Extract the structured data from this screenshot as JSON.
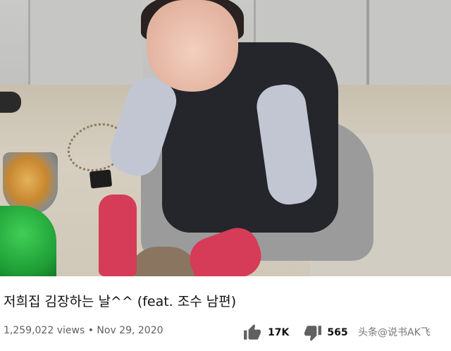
{
  "video": {
    "title": "저희집 김장하는 날^^ (feat. 조수 남편)",
    "views": "1,259,022 views",
    "separator": "•",
    "date": "Nov 29, 2020"
  },
  "actions": {
    "like_count": "17K",
    "dislike_count": "565",
    "like_icon": "thumbs-up-icon",
    "dislike_icon": "thumbs-down-icon"
  },
  "watermark": "头条@说书AK飞",
  "colors": {
    "title_text": "#111111",
    "meta_text": "#606060",
    "icon": "#606060"
  }
}
